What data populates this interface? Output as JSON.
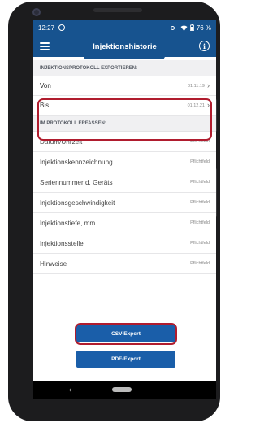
{
  "status_bar": {
    "time": "12:27",
    "battery": "76 %"
  },
  "header": {
    "title": "Injektionshistorie",
    "info_glyph": "i"
  },
  "export_section": {
    "header": "INJEKTIONSPROTOKOLL EXPORTIEREN:",
    "rows": [
      {
        "label": "Von",
        "value": "01.11.19"
      },
      {
        "label": "Bis",
        "value": "01.12.21"
      }
    ]
  },
  "protocol_section": {
    "header": "IM PROTOKOLL ERFASSEN:",
    "rows": [
      {
        "label": "Datum/Uhrzeit",
        "value": "Pflichtfeld"
      },
      {
        "label": "Injektionskennzeichnung",
        "value": "Pflichtfeld"
      },
      {
        "label": "Seriennummer d. Geräts",
        "value": "Pflichtfeld"
      },
      {
        "label": "Injektionsgeschwindigkeit",
        "value": "Pflichtfeld"
      },
      {
        "label": "Injektionstiefe, mm",
        "value": "Pflichtfeld"
      },
      {
        "label": "Injektionsstelle",
        "value": "Pflichtfeld"
      },
      {
        "label": "Hinweise",
        "value": "Pflichtfeld"
      }
    ]
  },
  "buttons": {
    "csv": "CSV-Export",
    "pdf": "PDF-Export"
  },
  "nav": {
    "back": "‹"
  },
  "colors": {
    "primary": "#17538f",
    "button": "#1a5ea9",
    "highlight": "#b01c2e"
  }
}
